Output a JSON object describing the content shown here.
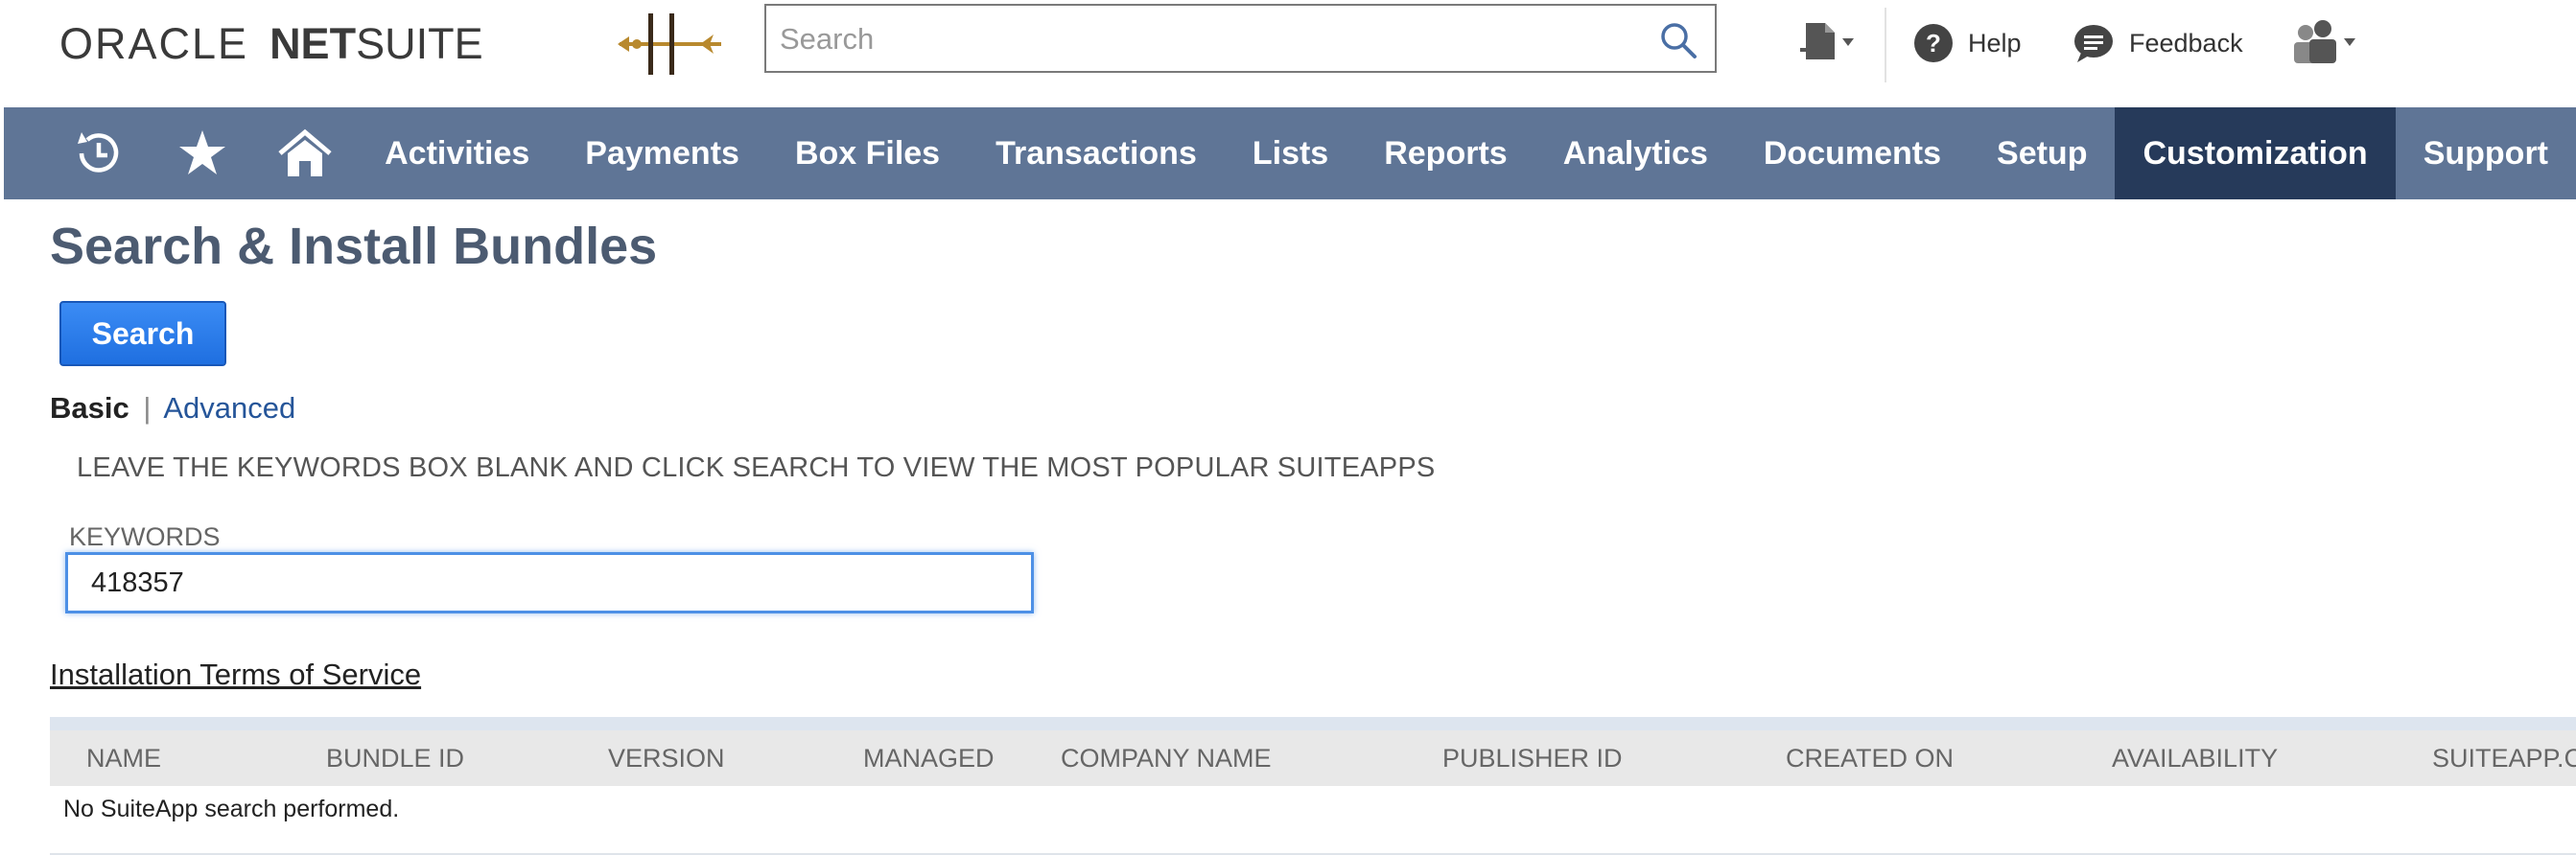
{
  "header": {
    "logo_oracle": "ORACLE",
    "logo_net": "NET",
    "logo_suite": "SUITE",
    "search_placeholder": "Search",
    "help_label": "Help",
    "feedback_label": "Feedback"
  },
  "nav": {
    "items": [
      "Activities",
      "Payments",
      "Box Files",
      "Transactions",
      "Lists",
      "Reports",
      "Analytics",
      "Documents",
      "Setup",
      "Customization",
      "Support"
    ],
    "active": "Customization"
  },
  "page": {
    "title": "Search & Install Bundles",
    "search_button": "Search",
    "mode_basic": "Basic",
    "mode_separator": "|",
    "mode_advanced": "Advanced",
    "hint": "LEAVE THE KEYWORDS BOX BLANK AND CLICK SEARCH TO VIEW THE MOST POPULAR SUITEAPPS",
    "keywords_label": "KEYWORDS",
    "keywords_value": "418357",
    "terms_link": "Installation Terms of Service"
  },
  "results": {
    "columns": [
      "NAME",
      "BUNDLE ID",
      "VERSION",
      "MANAGED",
      "COMPANY NAME",
      "PUBLISHER ID",
      "CREATED ON",
      "AVAILABILITY",
      "SUITEAPP.C"
    ],
    "empty_message": "No SuiteApp search performed."
  },
  "colors": {
    "navbar": "#5f7596",
    "nav_active": "#263a5a",
    "title": "#4c5b71",
    "button": "#2a7bea",
    "link": "#255599"
  }
}
